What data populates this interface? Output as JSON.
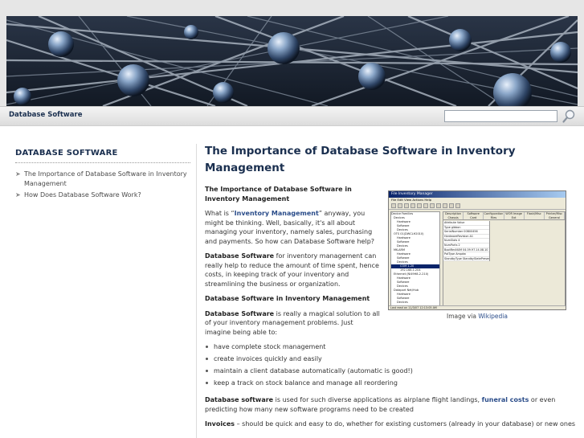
{
  "header": {
    "site_title": "Database Software",
    "search": {
      "value": "",
      "placeholder": ""
    }
  },
  "sidebar": {
    "heading": "DATABASE SOFTWARE",
    "links": [
      "The Importance of Database Software in Inventory Management",
      "How Does Database Software Work?"
    ]
  },
  "article": {
    "title": "The Importance of Database Software in Inventory Management",
    "subheading": "The Importance of Database Software in Inventory Management",
    "p1_pre": "What is “",
    "p1_link": "Inventory Management",
    "p1_post": "” anyway, you might be thinking. Well, basically, it's all about managing your inventory, namely sales, purchasing and payments. So how can Database Software help?",
    "p2_bold": "Database Software",
    "p2_rest": " for inventory management can really help to reduce the amount of time spent, hence costs, in keeping track of your inventory and streamlining the business or organization.",
    "subheading2": "Database Software in Inventory Management",
    "p3_bold": "Database Software",
    "p3_rest": " is really a magical solution to all of your inventory management problems. Just imagine being able to:",
    "bullets": [
      "have complete stock management",
      "create invoices quickly and easily",
      "maintain a client database automatically (automatic is good!)",
      "keep a track on stock balance and manage all reordering"
    ],
    "p4_bold": "Database software",
    "p4_mid": " is used for such diverse applications as airplane flight landings, ",
    "p4_link": "funeral costs",
    "p4_end": " or even predicting how many new software programs need to be created",
    "p5_bold": "Invoices",
    "p5_rest": " – should be quick and easy to do, whether for existing customers (already in your database) or new ones"
  },
  "figure": {
    "caption_pre": "Image via ",
    "caption_link": "Wikipedia",
    "screenshot": {
      "title": "File Inventory Manager",
      "menu": "File  Edit  View  Actions  Help",
      "tree": [
        "Device Families",
        "Devices",
        "Hardware",
        "Software",
        "Devices",
        "OTS 01(DWCLH2010)",
        "Hardware",
        "Software",
        "Devices",
        "MK-ARM",
        "Hardware",
        "Software",
        "Devices",
        "COM 1-20",
        "192.168.1.204",
        "Ethernet (NI49H8-2-210)",
        "Hardware",
        "Software",
        "Devices",
        "Dataport Net/Hub",
        "Hardware",
        "Software",
        "Devices"
      ],
      "tabs": [
        "Description Chassis",
        "Software Card",
        "Configuration Files",
        "WOR Image Ext",
        "Flash/Misc",
        "Printer/Misc General"
      ],
      "grid": [
        "Attribute  Value",
        "Type  gibbon",
        "SerialNumber  00B00456",
        "HardwareRevision  A1",
        "NumSlots  4",
        "NumPorts  2",
        "BootRevNUM  04.09.97.14.08.10",
        "PotType  Ampdw",
        "StandbyType  StandbyStatePresent"
      ],
      "status": "Last read on 11/3/07 12:13:05 AM"
    }
  },
  "colors": {
    "heading": "#1a2f4f",
    "link": "#2b4d8a",
    "header_bg": "#e6e6e6",
    "text": "#333333"
  },
  "icons": {
    "search_button": "magnifier-icon",
    "sidebar_bullet": "arrow-bullet-icon"
  }
}
